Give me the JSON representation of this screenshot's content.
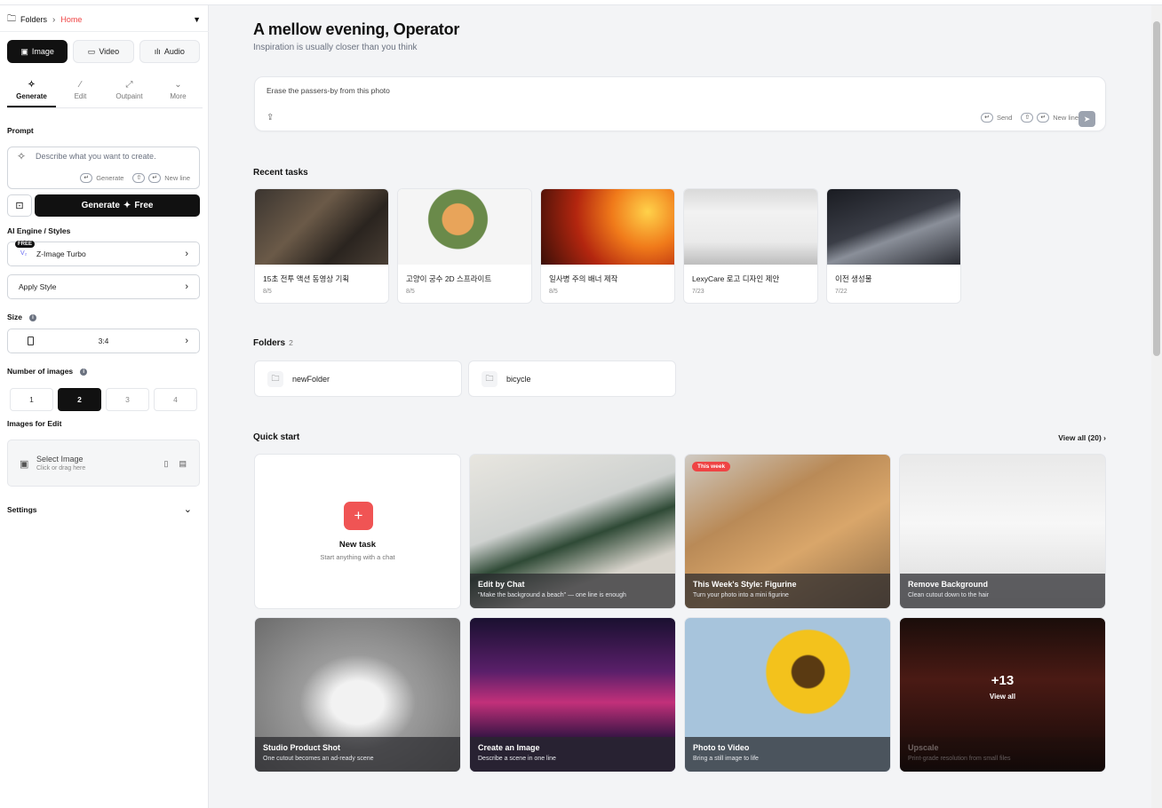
{
  "breadcrumb": {
    "root": "Folders",
    "current": "Home"
  },
  "media_tabs": [
    {
      "label": "Image",
      "icon": "image-icon"
    },
    {
      "label": "Video",
      "icon": "video-icon"
    },
    {
      "label": "Audio",
      "icon": "audio-icon"
    }
  ],
  "sub_tabs": [
    {
      "label": "Generate",
      "icon": "sparkle-icon"
    },
    {
      "label": "Edit",
      "icon": "magic-wand-icon"
    },
    {
      "label": "Outpaint",
      "icon": "expand-icon"
    },
    {
      "label": "More",
      "icon": "chevron-down-icon"
    }
  ],
  "prompt": {
    "label": "Prompt",
    "placeholder": "Describe what you want to create.",
    "hint_generate": "Generate",
    "hint_newline": "New line"
  },
  "generate_button": {
    "label": "Generate",
    "suffix": "Free"
  },
  "engine": {
    "label": "AI Engine / Styles",
    "badge": "FREE",
    "value": "Z-Image Turbo",
    "apply_style": "Apply Style"
  },
  "size": {
    "label": "Size",
    "value": "3:4"
  },
  "num_images": {
    "label": "Number of images",
    "options": [
      "1",
      "2",
      "3",
      "4"
    ],
    "selected": "2"
  },
  "images_for_edit": {
    "label": "Images for Edit",
    "title": "Select Image",
    "hint": "Click or drag here"
  },
  "settings": {
    "label": "Settings"
  },
  "greeting": {
    "title": "A mellow evening, Operator",
    "subtitle": "Inspiration is usually closer than you think"
  },
  "chat": {
    "text": "Erase the passers-by from this photo",
    "hint_send": "Send",
    "hint_newline": "New line"
  },
  "recent": {
    "title": "Recent tasks",
    "tasks": [
      {
        "title": "15초 전투 액션 동영상 기획",
        "date": "8/5"
      },
      {
        "title": "고양이 궁수 2D 스프라이트",
        "date": "8/5"
      },
      {
        "title": "일사병 주의 배너 제작",
        "date": "8/5"
      },
      {
        "title": "LexyCare 로고 디자인 제안",
        "date": "7/23"
      },
      {
        "title": "이전 생성물",
        "date": "7/22"
      }
    ]
  },
  "folders": {
    "title": "Folders",
    "count": "2",
    "items": [
      "newFolder",
      "bicycle"
    ]
  },
  "quickstart": {
    "title": "Quick start",
    "view_all": "View all (20)",
    "new_task": {
      "title": "New task",
      "desc": "Start anything with a chat"
    },
    "cards": [
      {
        "title": "Edit by Chat",
        "desc": "\"Make the background a beach\" — one line is enough"
      },
      {
        "title": "This Week's Style: Figurine",
        "desc": "Turn your photo into a mini figurine",
        "badge": "This week"
      },
      {
        "title": "Remove Background",
        "desc": "Clean cutout down to the hair"
      },
      {
        "title": "Studio Product Shot",
        "desc": "One cutout becomes an ad-ready scene"
      },
      {
        "title": "Create an Image",
        "desc": "Describe a scene in one line"
      },
      {
        "title": "Photo to Video",
        "desc": "Bring a still image to life"
      },
      {
        "title": "Upscale",
        "desc": "Print-grade resolution from small files",
        "more_count": "+13",
        "more_label": "View all"
      }
    ]
  }
}
